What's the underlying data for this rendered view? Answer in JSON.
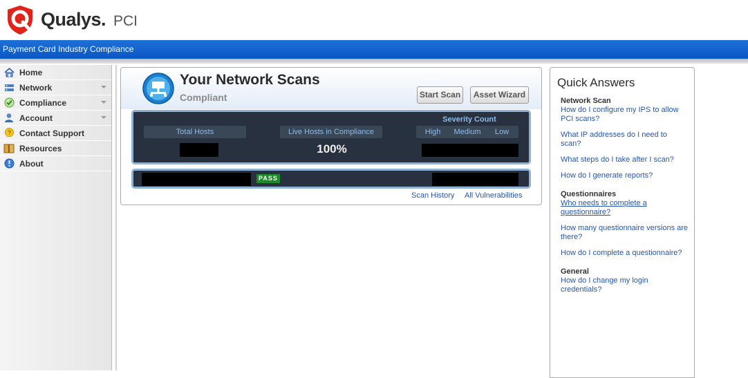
{
  "brand": {
    "name": "Qualys.",
    "product": "PCI"
  },
  "banner": "Payment Card Industry Compliance",
  "sidebar": {
    "items": [
      {
        "label": "Home",
        "icon": "home-icon",
        "has_menu": false
      },
      {
        "label": "Network",
        "icon": "network-icon",
        "has_menu": true
      },
      {
        "label": "Compliance",
        "icon": "compliance-check-icon",
        "has_menu": true
      },
      {
        "label": "Account",
        "icon": "user-icon",
        "has_menu": true
      },
      {
        "label": "Contact Support",
        "icon": "support-bubble-icon",
        "has_menu": false
      },
      {
        "label": "Resources",
        "icon": "book-icon",
        "has_menu": false
      },
      {
        "label": "About",
        "icon": "info-icon",
        "has_menu": false
      }
    ]
  },
  "scans": {
    "title": "Your Network Scans",
    "status": "Compliant",
    "start_scan": "Start Scan",
    "asset_wizard": "Asset Wizard",
    "total_hosts_label": "Total Hosts",
    "live_hosts_label": "Live Hosts in Compliance",
    "live_hosts_value": "100%",
    "severity_title": "Severity Count",
    "severity_labels": {
      "high": "High",
      "medium": "Medium",
      "low": "Low"
    },
    "pass_badge": "PASS",
    "scan_history": "Scan History",
    "all_vulnerabilities": "All Vulnerabilities"
  },
  "quick_answers": {
    "title": "Quick Answers",
    "sections": [
      {
        "heading": "Network Scan",
        "links": [
          "How do I configure my IPS to allow PCI scans?",
          "What IP addresses do I need to scan?",
          "What steps do I take after I scan?",
          "How do I generate reports?"
        ]
      },
      {
        "heading": "Questionnaires",
        "links": [
          "Who needs to complete a questionnaire?",
          "How many questionnaire versions are there?",
          "How do I complete a questionnaire?"
        ]
      },
      {
        "heading": "General",
        "links": [
          "How do I change my login credentials?"
        ]
      }
    ]
  },
  "colors": {
    "accent_blue": "#0857c4",
    "link": "#2557a8",
    "dark_panel": "#273140",
    "pass_green": "#1d8a2a",
    "brand_red": "#e2231a"
  }
}
